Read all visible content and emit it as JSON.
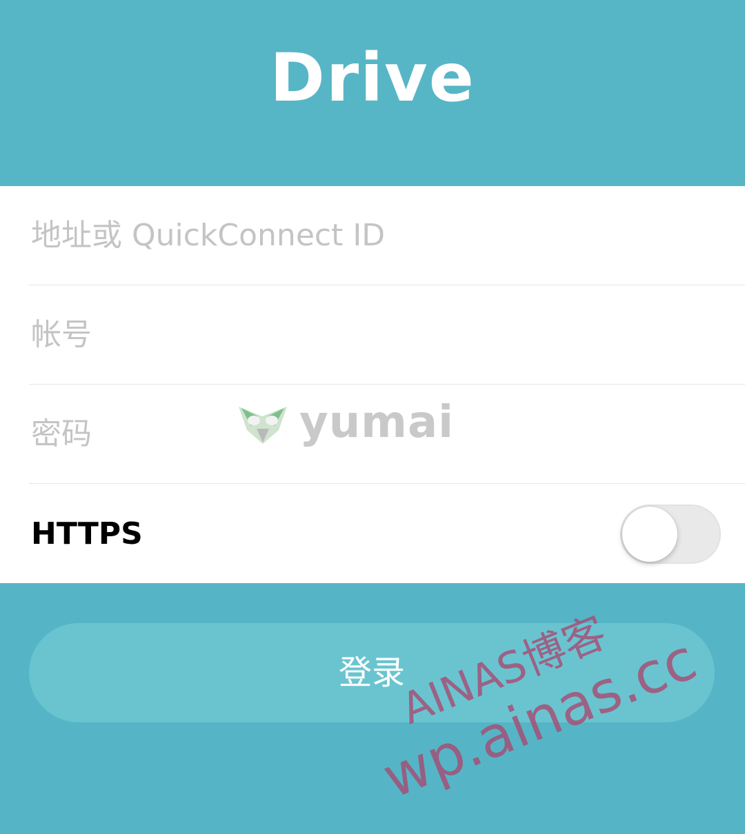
{
  "header": {
    "title": "Drive",
    "background": "#57b6c6"
  },
  "form": {
    "address_placeholder": "地址或 QuickConnect ID",
    "account_placeholder": "帐号",
    "password_placeholder": "密码",
    "https_label": "HTTPS",
    "https_enabled": false
  },
  "login": {
    "label": "登录",
    "color": "#6ac4d0"
  },
  "watermarks": {
    "logo_text": "yumai",
    "logo_icon": "owl-mask-icon",
    "line1": "AINAS博客",
    "line2": "wp.ainas.cc",
    "color": "#aa466e"
  },
  "colors": {
    "page_background": "#55b5c6",
    "form_background": "#ffffff",
    "placeholder": "#c4c4c4"
  }
}
